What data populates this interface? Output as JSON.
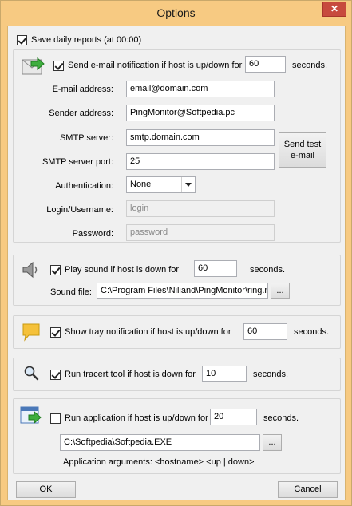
{
  "window": {
    "title": "Options",
    "close_glyph": "✕"
  },
  "daily_reports": {
    "label": "Save daily reports (at 00:00)",
    "checked": true
  },
  "email": {
    "icon": "email-forward-icon",
    "enable_label": "Send e-mail notification if host is up/down for",
    "enabled": true,
    "duration": "60",
    "seconds_label": "seconds.",
    "address_label": "E-mail address:",
    "address_value": "email@domain.com",
    "sender_label": "Sender address:",
    "sender_value": "PingMonitor@Softpedia.pc",
    "smtp_server_label": "SMTP server:",
    "smtp_server_value": "smtp.domain.com",
    "smtp_port_label": "SMTP server port:",
    "smtp_port_value": "25",
    "auth_label": "Authentication:",
    "auth_value": "None",
    "login_label": "Login/Username:",
    "login_placeholder": "login",
    "password_label": "Password:",
    "password_placeholder": "password",
    "test_button_line1": "Send test",
    "test_button_line2": "e-mail"
  },
  "sound": {
    "icon": "speaker-icon",
    "enable_label": "Play sound if host is down for",
    "enabled": true,
    "duration": "60",
    "seconds_label": "seconds.",
    "file_label": "Sound file:",
    "file_value": "C:\\Program Files\\Niliand\\PingMonitor\\ring.m",
    "browse_label": "..."
  },
  "tray": {
    "icon": "notification-bubble-icon",
    "enable_label": "Show tray notification if host is up/down for",
    "enabled": true,
    "duration": "60",
    "seconds_label": "seconds."
  },
  "tracert": {
    "icon": "magnifier-icon",
    "enable_label": "Run tracert tool if host is down for",
    "enabled": true,
    "duration": "10",
    "seconds_label": "seconds."
  },
  "application": {
    "icon": "run-application-icon",
    "enable_label": "Run application if host is up/down for",
    "enabled": false,
    "duration": "20",
    "seconds_label": "seconds.",
    "path_value": "C:\\Softpedia\\Softpedia.EXE",
    "browse_label": "...",
    "args_label": "Application arguments: <hostname> <up | down>"
  },
  "footer": {
    "ok_label": "OK",
    "cancel_label": "Cancel"
  }
}
